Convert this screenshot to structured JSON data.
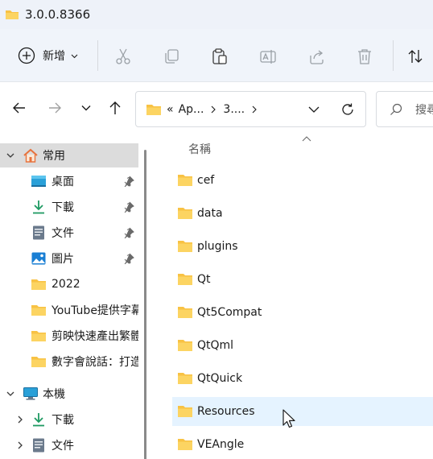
{
  "window": {
    "title": "3.0.0.8366"
  },
  "toolbar": {
    "new_label": "新增",
    "icons": [
      "cut-icon",
      "copy-icon",
      "paste-icon",
      "rename-icon",
      "share-icon",
      "delete-icon",
      "sort-icon"
    ]
  },
  "address": {
    "overflow": "«",
    "crumbs": [
      "Ap...",
      "3...."
    ],
    "search_placeholder": "搜尋"
  },
  "sidebar": {
    "items": [
      {
        "label": "常用",
        "icon": "home-icon",
        "expander": "expanded",
        "pinned": false,
        "selected": true
      },
      {
        "label": "桌面",
        "icon": "desktop-icon",
        "expander": "",
        "pinned": true,
        "selected": false
      },
      {
        "label": "下載",
        "icon": "download-icon",
        "expander": "",
        "pinned": true,
        "selected": false
      },
      {
        "label": "文件",
        "icon": "document-icon",
        "expander": "",
        "pinned": true,
        "selected": false
      },
      {
        "label": "圖片",
        "icon": "picture-icon",
        "expander": "",
        "pinned": true,
        "selected": false
      },
      {
        "label": "2022",
        "icon": "folder-icon",
        "expander": "",
        "pinned": false,
        "selected": false
      },
      {
        "label": "YouTube提供字幕",
        "icon": "folder-icon",
        "expander": "",
        "pinned": false,
        "selected": false
      },
      {
        "label": "剪映快速產出繁體",
        "icon": "folder-icon",
        "expander": "",
        "pinned": false,
        "selected": false
      },
      {
        "label": "數字會說話：打造",
        "icon": "folder-icon",
        "expander": "",
        "pinned": false,
        "selected": false
      },
      {
        "label": "本機",
        "icon": "computer-icon",
        "expander": "expanded",
        "pinned": false,
        "selected": false
      },
      {
        "label": "下載",
        "icon": "download-icon",
        "expander": "collapsed",
        "pinned": false,
        "selected": false
      },
      {
        "label": "文件",
        "icon": "document-icon",
        "expander": "collapsed",
        "pinned": false,
        "selected": false
      }
    ]
  },
  "content": {
    "column_header": "名稱",
    "files": [
      {
        "name": "cef",
        "hover": false
      },
      {
        "name": "data",
        "hover": false
      },
      {
        "name": "plugins",
        "hover": false
      },
      {
        "name": "Qt",
        "hover": false
      },
      {
        "name": "Qt5Compat",
        "hover": false
      },
      {
        "name": "QtQml",
        "hover": false
      },
      {
        "name": "QtQuick",
        "hover": false
      },
      {
        "name": "Resources",
        "hover": true
      },
      {
        "name": "VEAngle",
        "hover": false
      }
    ]
  },
  "colors": {
    "folder": "#f8c244",
    "accent": "#0067c0",
    "hover_row": "#e5f3ff",
    "selected_nav": "#dcdcdc"
  }
}
